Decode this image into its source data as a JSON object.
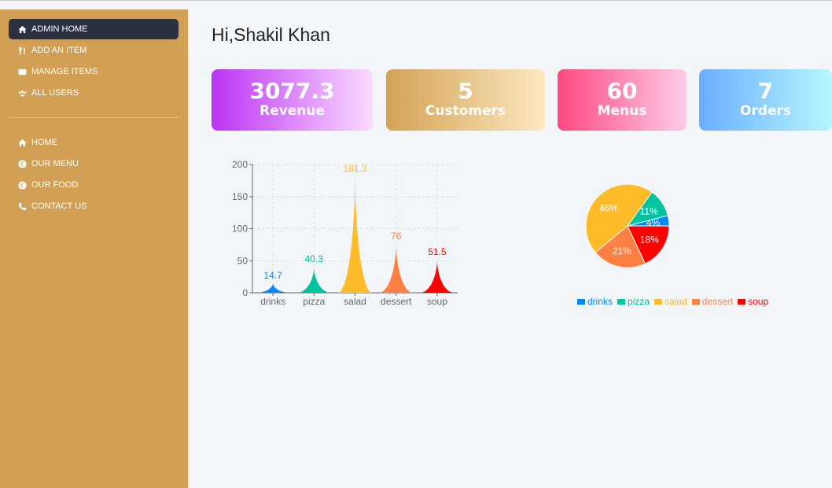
{
  "sidebar": {
    "admin_items": [
      {
        "label": "ADMIN HOME",
        "icon": "home-icon",
        "active": true
      },
      {
        "label": "ADD AN ITEM",
        "icon": "utensils-icon",
        "active": false
      },
      {
        "label": "MANAGE ITEMS",
        "icon": "wallet-icon",
        "active": false
      },
      {
        "label": "ALL USERS",
        "icon": "users-icon",
        "active": false
      }
    ],
    "public_items": [
      {
        "label": "HOME",
        "icon": "home-icon"
      },
      {
        "label": "OUR MENU",
        "icon": "arrow-circle-left-icon"
      },
      {
        "label": "OUR FOOD",
        "icon": "arrow-circle-left-icon"
      },
      {
        "label": "CONTACT US",
        "icon": "phone-icon"
      }
    ]
  },
  "header": {
    "greeting": "Hi,Shakil Khan"
  },
  "stats": [
    {
      "value": "3077.3",
      "label": "Revenue"
    },
    {
      "value": "5",
      "label": "Customers"
    },
    {
      "value": "60",
      "label": "Menus"
    },
    {
      "value": "7",
      "label": "Orders"
    }
  ],
  "colors": {
    "sidebar": "#d1a054",
    "active_nav": "#2b3140",
    "drinks": "#0088fe",
    "pizza": "#00c49f",
    "salad": "#ffbb28",
    "dessert": "#ff8042",
    "soup": "#ff0000"
  },
  "chart_data": [
    {
      "type": "bar",
      "categories": [
        "drinks",
        "pizza",
        "salad",
        "dessert",
        "soup"
      ],
      "values": [
        14.7,
        40.3,
        181.3,
        76,
        51.5
      ],
      "value_labels": [
        "14.7",
        "40.3",
        "181.3",
        "76",
        "51.5"
      ],
      "yticks": [
        "0",
        "50",
        "100",
        "150",
        "200"
      ],
      "ylim": [
        0,
        200
      ],
      "grid": true
    },
    {
      "type": "pie",
      "categories": [
        "drinks",
        "pizza",
        "salad",
        "dessert",
        "soup"
      ],
      "values": [
        4,
        11,
        46,
        21,
        18
      ],
      "labels": [
        "4%",
        "11%",
        "46%",
        "21%",
        "18%"
      ],
      "legend_position": "bottom"
    }
  ]
}
